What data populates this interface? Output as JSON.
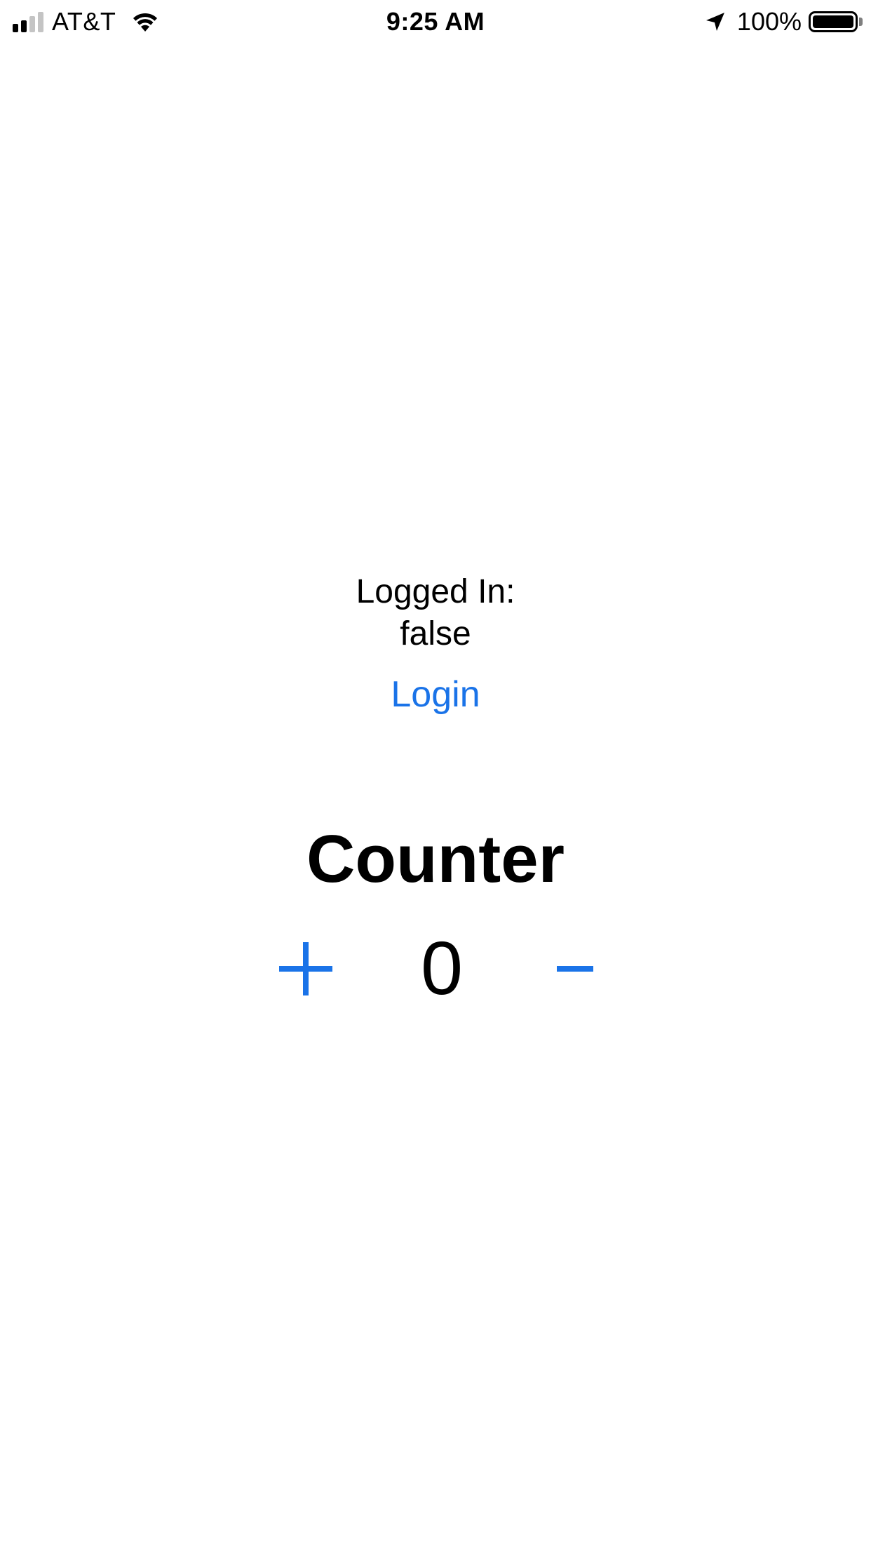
{
  "status_bar": {
    "carrier": "AT&T",
    "time": "9:25 AM",
    "battery_percent": "100%",
    "battery_level": 1.0,
    "signal_bars_active": 2,
    "signal_bars_total": 4,
    "icons": {
      "wifi": "wifi-icon",
      "location": "location-arrow-icon",
      "battery": "battery-icon"
    }
  },
  "auth": {
    "label": "Logged In:",
    "value": "false",
    "login_button": "Login"
  },
  "counter": {
    "title": "Counter",
    "value": "0",
    "increment_icon": "plus-icon",
    "decrement_icon": "minus-icon"
  },
  "colors": {
    "accent": "#1a73e8",
    "text": "#000000",
    "background": "#ffffff",
    "signal_inactive": "#c4c4c4"
  }
}
